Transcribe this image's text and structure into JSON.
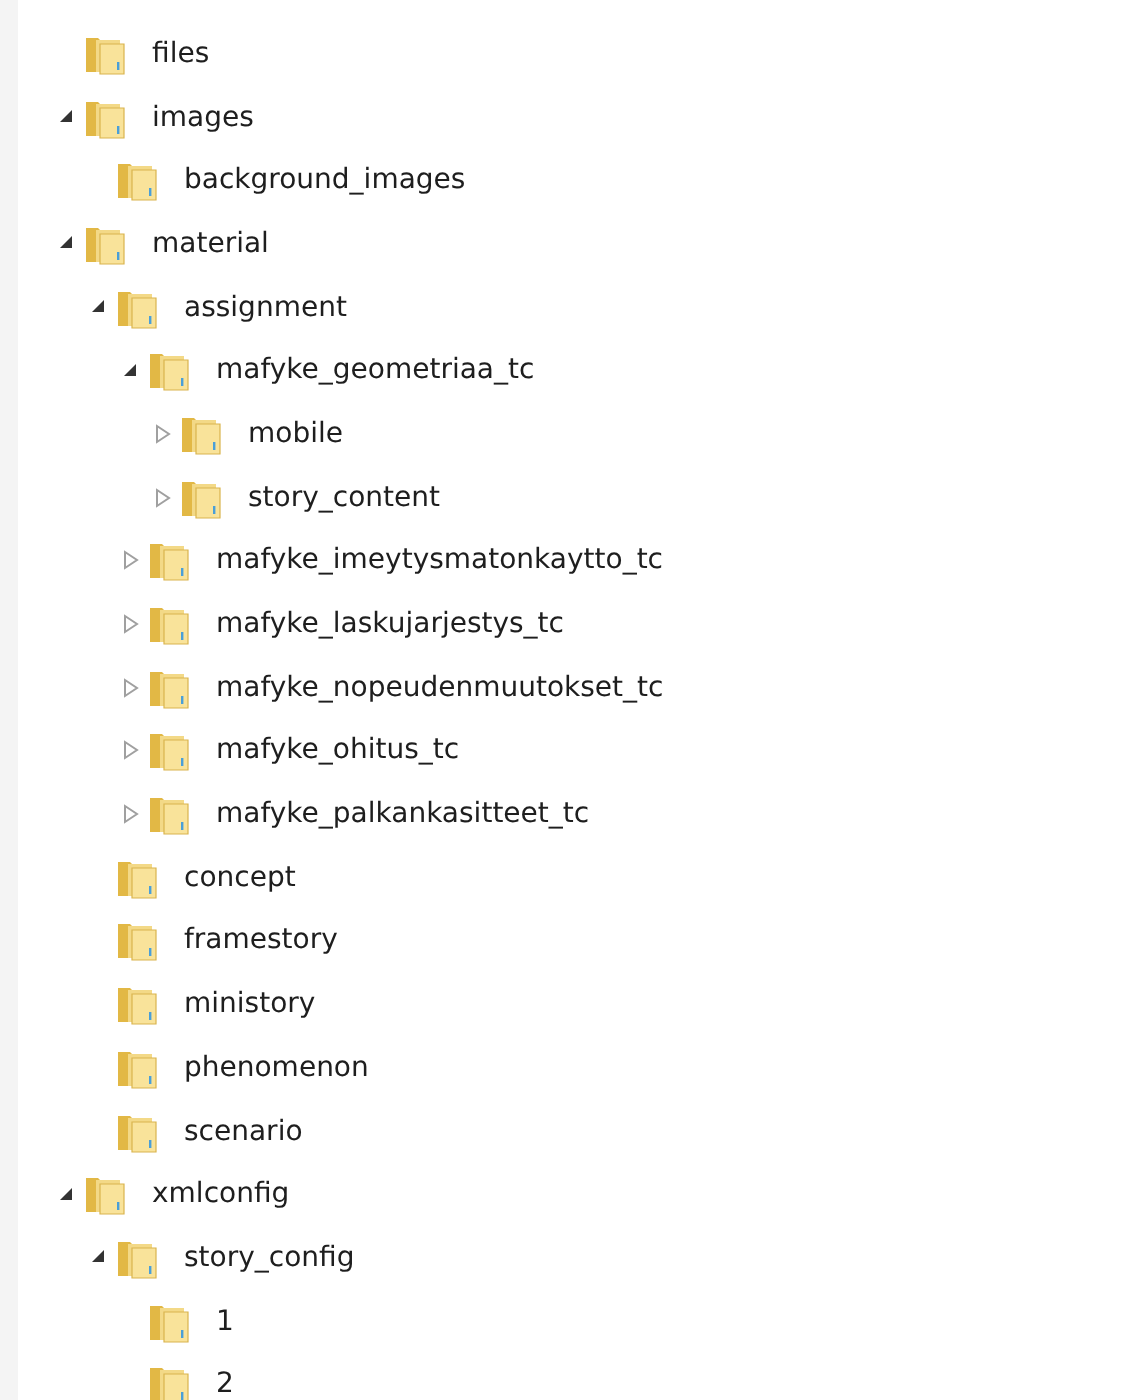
{
  "tree": [
    {
      "label": "files"
    },
    {
      "label": "images",
      "expanded": true,
      "children": [
        {
          "label": "background_images"
        }
      ]
    },
    {
      "label": "material",
      "expanded": true,
      "children": [
        {
          "label": "assignment",
          "expanded": true,
          "children": [
            {
              "label": "mafyke_geometriaa_tc",
              "expanded": true,
              "children": [
                {
                  "label": "mobile",
                  "expanded": false
                },
                {
                  "label": "story_content",
                  "expanded": false
                }
              ]
            },
            {
              "label": "mafyke_imeytysmatonkaytto_tc",
              "expanded": false
            },
            {
              "label": "mafyke_laskujarjestys_tc",
              "expanded": false
            },
            {
              "label": "mafyke_nopeudenmuutokset_tc",
              "expanded": false
            },
            {
              "label": "mafyke_ohitus_tc",
              "expanded": false
            },
            {
              "label": "mafyke_palkankasitteet_tc",
              "expanded": false
            }
          ]
        },
        {
          "label": "concept"
        },
        {
          "label": "framestory"
        },
        {
          "label": "ministory"
        },
        {
          "label": "phenomenon"
        },
        {
          "label": "scenario"
        }
      ]
    },
    {
      "label": "xmlconfig",
      "expanded": true,
      "children": [
        {
          "label": "story_config",
          "expanded": true,
          "children": [
            {
              "label": "1"
            },
            {
              "label": "2"
            }
          ]
        }
      ]
    }
  ]
}
